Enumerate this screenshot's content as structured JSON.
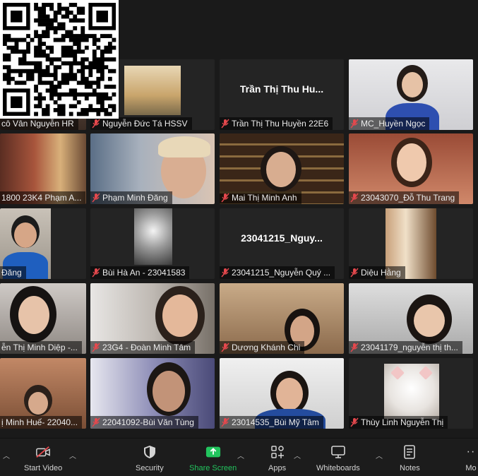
{
  "participants": [
    {
      "label": "cô Vân Nguyễn HR"
    },
    {
      "label": "Nguyễn Đức Tá HSSV"
    },
    {
      "label": "Trần Thị Thu Huyền 22E6",
      "display_name": "Trần Thị Thu Hu..."
    },
    {
      "label": "MC_Huyền Ngọc"
    },
    {
      "label": "1800 23K4 Phạm A..."
    },
    {
      "label": "Phạm Minh Đăng"
    },
    {
      "label": "Mai Thị Minh Anh"
    },
    {
      "label": "23043070_Đỗ Thu Trang"
    },
    {
      "label": "Đăng"
    },
    {
      "label": "Bùi Hà An - 23041583"
    },
    {
      "label": "23041215_Nguyễn Quý ...",
      "display_name": "23041215_Nguy..."
    },
    {
      "label": "Diệu Hằng"
    },
    {
      "label": "ễn Thị Minh Diệp -..."
    },
    {
      "label": "23G4 - Đoàn Minh Tâm"
    },
    {
      "label": "Dương Khánh Chi"
    },
    {
      "label": "23041179_nguyễn thị th..."
    },
    {
      "label": "ị Minh Huế- 22040..."
    },
    {
      "label": "22041092-Bùi Văn Tùng"
    },
    {
      "label": "23014535_Bùi Mỹ Tâm"
    },
    {
      "label": "Thùy Linh Nguyễn Thị"
    }
  ],
  "toolbar": {
    "start_video": "Start Video",
    "security": "Security",
    "share_screen": "Share Screen",
    "apps": "Apps",
    "whiteboards": "Whiteboards",
    "notes": "Notes",
    "more": "Mo"
  },
  "colors": {
    "share_green": "#22c55e",
    "mic_muted": "#e5484d",
    "tile_bg": "#242424"
  }
}
